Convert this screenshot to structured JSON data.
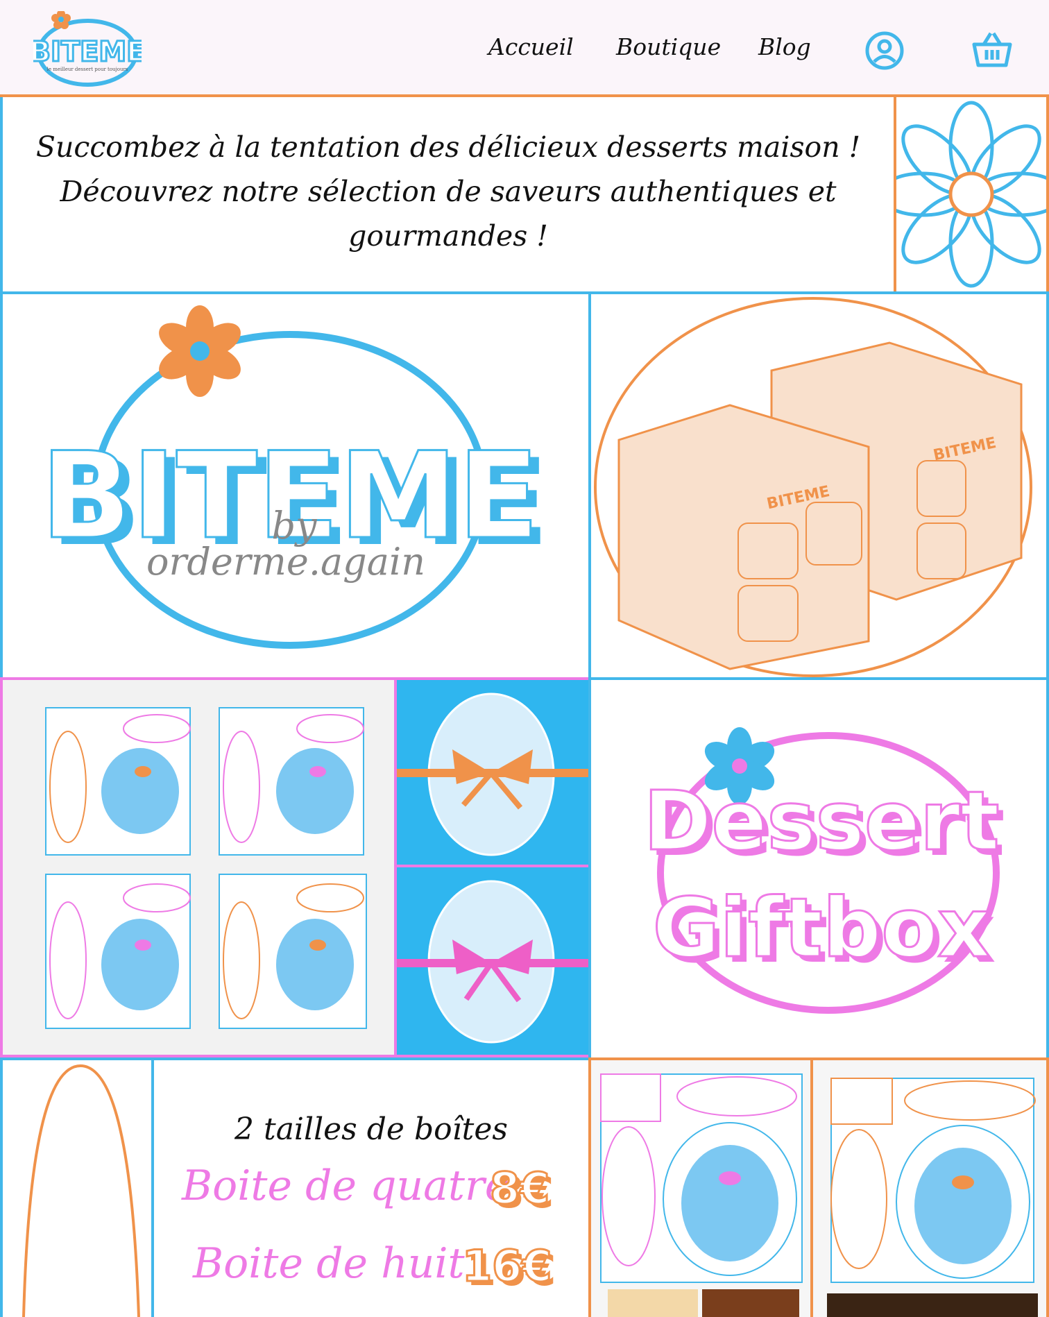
{
  "header": {
    "logo_text": "BITEME",
    "logo_tagline": "le meilleur dessert pour toujours",
    "nav": [
      "Accueil",
      "Boutique",
      "Blog"
    ]
  },
  "intro": {
    "line1": "Succombez à la tentation des délicieux desserts maison !",
    "line2": "Découvrez notre sélection de saveurs authentiques et",
    "line3": "gourmandes !"
  },
  "brand_card": {
    "title": "BITEME",
    "by": "by",
    "subtitle": "orderme.again"
  },
  "giftbox": {
    "word1": "Dessert",
    "word2": "Giftbox"
  },
  "box_photo": {
    "label": "BITEME"
  },
  "sizes": {
    "heading": "2 tailles de boîtes",
    "items": [
      {
        "label": "Boite de quatre",
        "price": "8€"
      },
      {
        "label": "Boite de huit",
        "price": "16€"
      }
    ]
  },
  "colors": {
    "blue": "#42b7ea",
    "orange": "#f0924a",
    "pink": "#ee7ae5"
  },
  "icons": [
    "flower-icon",
    "user-icon",
    "basket-icon"
  ]
}
